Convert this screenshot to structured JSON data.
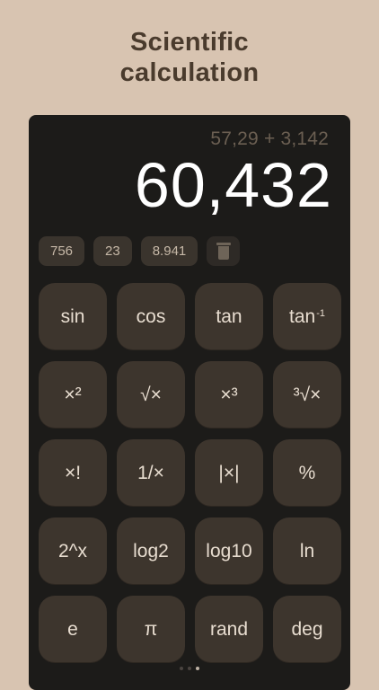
{
  "headline": {
    "line1": "Scientific",
    "line2": "calculation"
  },
  "display": {
    "expression": "57,29 + 3,142",
    "result": "60,432"
  },
  "memory": {
    "items": [
      "756",
      "23",
      "8.941"
    ],
    "trash_icon": "trash-icon"
  },
  "keys": [
    {
      "label": "sin",
      "sup": ""
    },
    {
      "label": "cos",
      "sup": ""
    },
    {
      "label": "tan",
      "sup": ""
    },
    {
      "label": "tan",
      "sup": "-1"
    },
    {
      "label": "×²",
      "sup": ""
    },
    {
      "label": "√×",
      "sup": ""
    },
    {
      "label": "×³",
      "sup": ""
    },
    {
      "label": "³√×",
      "sup": ""
    },
    {
      "label": "×!",
      "sup": ""
    },
    {
      "label": "1/×",
      "sup": ""
    },
    {
      "label": "|×|",
      "sup": ""
    },
    {
      "label": "%",
      "sup": ""
    },
    {
      "label": "2^x",
      "sup": ""
    },
    {
      "label": "log2",
      "sup": ""
    },
    {
      "label": "log10",
      "sup": ""
    },
    {
      "label": "ln",
      "sup": ""
    },
    {
      "label": "e",
      "sup": ""
    },
    {
      "label": "π",
      "sup": ""
    },
    {
      "label": "rand",
      "sup": ""
    },
    {
      "label": "deg",
      "sup": ""
    }
  ],
  "pager": {
    "count": 3,
    "active_index": 2
  },
  "colors": {
    "background": "#d8c4b1",
    "panel": "#1c1b19",
    "key": "#3d352d",
    "chip": "#3a342d",
    "headline": "#4a3b2d"
  }
}
